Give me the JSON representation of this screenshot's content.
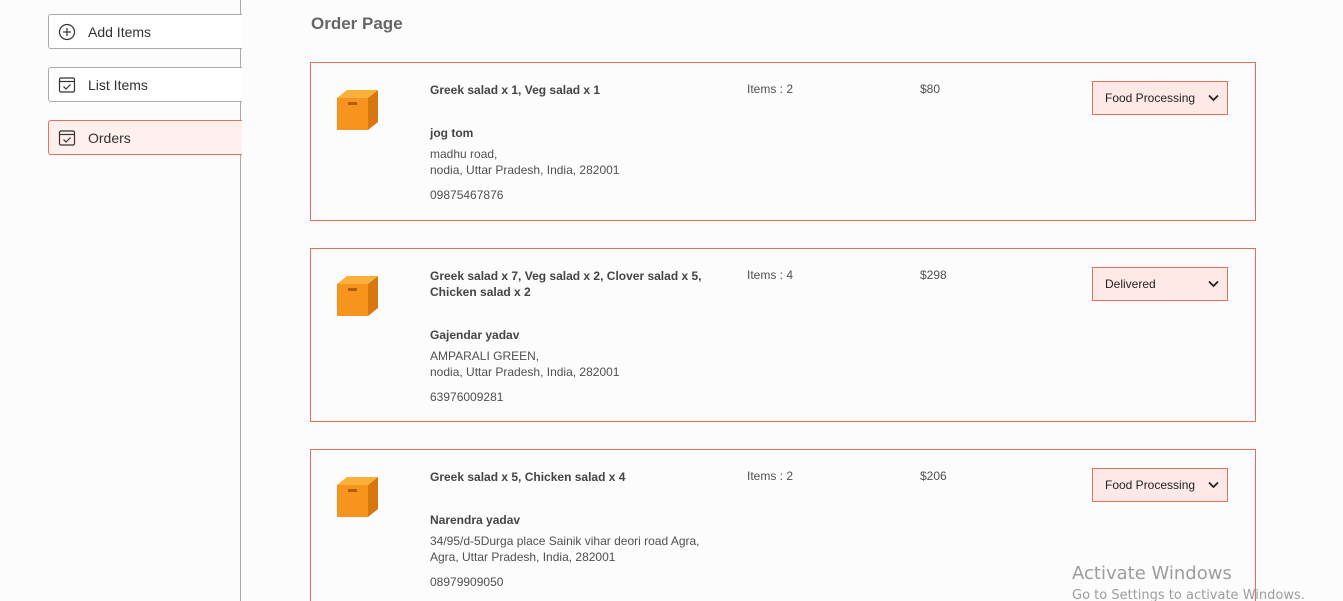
{
  "sidebar": {
    "items": [
      {
        "label": "Add Items",
        "icon": "add-circle-icon",
        "active": false
      },
      {
        "label": "List Items",
        "icon": "calendar-check-icon",
        "active": false
      },
      {
        "label": "Orders",
        "icon": "calendar-check-icon",
        "active": true
      }
    ]
  },
  "main": {
    "title": "Order Page",
    "orders": [
      {
        "items": "Greek salad x 1, Veg salad x 1",
        "customer": "jog tom",
        "address_line1": "madhu road,",
        "address_line2": "nodia, Uttar Pradesh, India, 282001",
        "phone": "09875467876",
        "count": "Items : 2",
        "amount": "$80",
        "status": "Food Processing"
      },
      {
        "items": "Greek salad x 7, Veg salad x 2, Clover salad x 5, Chicken salad x 2",
        "customer": "Gajendar yadav",
        "address_line1": "AMPARALI GREEN,",
        "address_line2": "nodia, Uttar Pradesh, India, 282001",
        "phone": "63976009281",
        "count": "Items : 4",
        "amount": "$298",
        "status": "Delivered"
      },
      {
        "items": "Greek salad x 5, Chicken salad x 4",
        "customer": "Narendra yadav",
        "address_line1": "34/95/d-5Durga place Sainik vihar deori road Agra,",
        "address_line2": "Agra, Uttar Pradesh, India, 282001",
        "phone": "08979909050",
        "count": "Items : 2",
        "amount": "$206",
        "status": "Food Processing"
      }
    ]
  },
  "watermark": {
    "title": "Activate Windows",
    "subtitle": "Go to Settings to activate Windows."
  },
  "colors": {
    "accent": "#e0705c",
    "active_bg": "#fff0ee",
    "select_bg": "#ffe9e6",
    "box_orange": "#f7941d"
  }
}
